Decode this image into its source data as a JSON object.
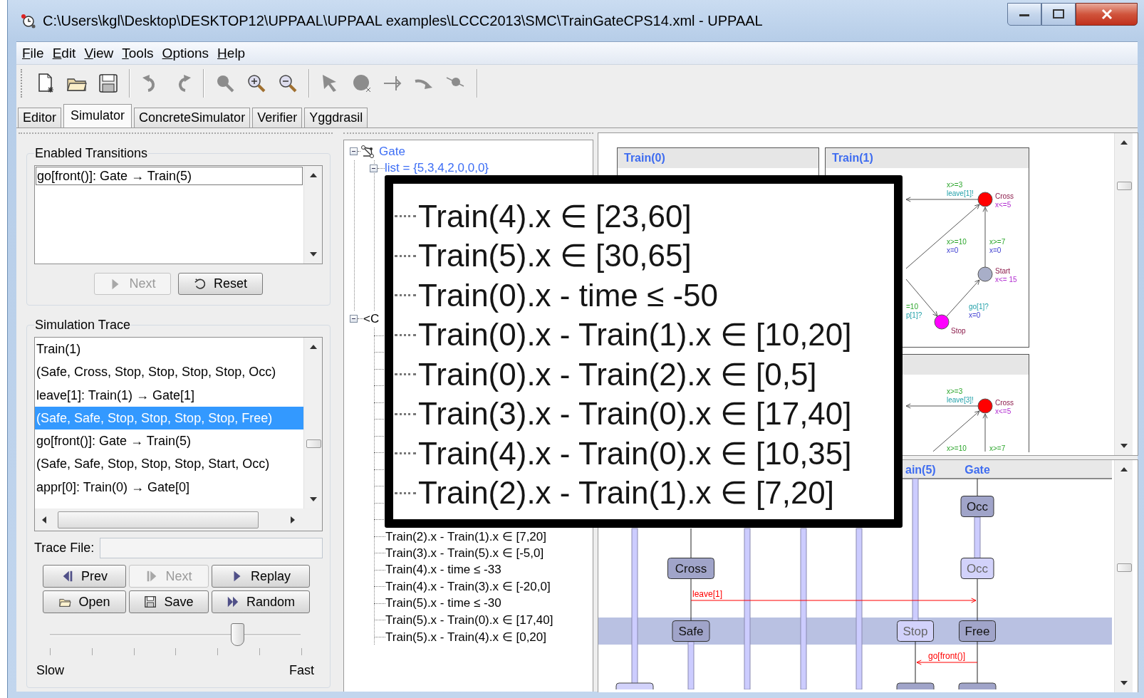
{
  "window": {
    "title": "C:\\Users\\kgl\\Desktop\\DESKTOP12\\UPPAAL\\UPPAAL examples\\LCCC2013\\SMC\\TrainGateCPS14.xml - UPPAAL"
  },
  "menu": [
    "File",
    "Edit",
    "View",
    "Tools",
    "Options",
    "Help"
  ],
  "tabs": [
    {
      "label": "Editor",
      "selected": false
    },
    {
      "label": "Simulator",
      "selected": true
    },
    {
      "label": "ConcreteSimulator",
      "selected": false
    },
    {
      "label": "Verifier",
      "selected": false
    },
    {
      "label": "Yggdrasil",
      "selected": false
    }
  ],
  "enabled_transitions": {
    "title": "Enabled Transitions",
    "items": [
      {
        "label": "go[front()]: Gate → Train(5)",
        "selected": true
      }
    ],
    "buttons": [
      {
        "label": "Next",
        "kind": "next",
        "disabled": true
      },
      {
        "label": "Reset",
        "kind": "reset",
        "disabled": false
      }
    ]
  },
  "simulation_trace": {
    "title": "Simulation Trace",
    "items": [
      {
        "label": "Train(1)",
        "selected": false
      },
      {
        "label": "(Safe, Cross, Stop, Stop, Stop, Stop, Occ)",
        "selected": false
      },
      {
        "label": "leave[1]: Train(1) → Gate[1]",
        "selected": false
      },
      {
        "label": "(Safe, Safe, Stop, Stop, Stop, Stop, Free)",
        "selected": true
      },
      {
        "label": "go[front()]: Gate → Train(5)",
        "selected": false
      },
      {
        "label": "(Safe, Safe, Stop, Stop, Stop, Start, Occ)",
        "selected": false
      },
      {
        "label": "appr[0]: Train(0) → Gate[0]",
        "selected": false
      }
    ],
    "trace_file_label": "Trace File:",
    "buttons": [
      {
        "label": "Prev",
        "kind": "prev",
        "disabled": false
      },
      {
        "label": "Next",
        "kind": "step",
        "disabled": true
      },
      {
        "label": "Replay",
        "kind": "replay",
        "disabled": false
      },
      {
        "label": "Open",
        "kind": "open",
        "disabled": false
      },
      {
        "label": "Save",
        "kind": "save",
        "disabled": false
      },
      {
        "label": "Random",
        "kind": "random",
        "disabled": false
      }
    ],
    "speed": {
      "level": 0.75,
      "min_label": "Slow",
      "max_label": "Fast"
    }
  },
  "tree": {
    "items": [
      {
        "label": "Gate",
        "kind": "process",
        "expanded": true,
        "children": [
          {
            "label": "list = {5,3,4,2,0,0,0}",
            "kind": "variable",
            "expanded": true
          }
        ]
      },
      {
        "label": "<C",
        "kind": "group",
        "expanded": true,
        "children": [
          {
            "label": "Train(2).x - Train(1).x ∈ [7,20]"
          },
          {
            "label": "Train(3).x - Train(5).x ∈ [-5,0]"
          },
          {
            "label": "Train(4).x - time ≤ -33"
          },
          {
            "label": "Train(4).x - Train(3).x ∈ [-20,0]"
          },
          {
            "label": "Train(5).x - time ≤ -30"
          },
          {
            "label": "Train(5).x - Train(0).x ∈ [17,40]"
          },
          {
            "label": "Train(5).x - Train(4).x ∈ [0,20]"
          }
        ]
      }
    ]
  },
  "processes": [
    {
      "name": "Train(0)"
    },
    {
      "name": "Train(1)",
      "locations": [
        {
          "name": "Cross",
          "invariant": "x<=5",
          "color": "#ff0000"
        },
        {
          "name": "Start",
          "invariant": "x<= 15",
          "color": "#a8aec8"
        },
        {
          "name": "Stop",
          "color": "#ff00ff"
        }
      ],
      "edges": [
        {
          "guard": "x>=3",
          "sync": "leave[1]!"
        },
        {
          "guard": "x>=10",
          "update": "x=0"
        },
        {
          "guard": "x>=7",
          "update": "x=0"
        },
        {
          "sync": "go[1]?",
          "update": "x=0"
        },
        {
          "guard": "=10",
          "sync": "p[1]?"
        }
      ]
    },
    {
      "locations": [
        {
          "name": "Cross",
          "invariant": "x<=5",
          "color": "#ff0000"
        }
      ],
      "edges": [
        {
          "guard": "x>=3",
          "sync": "leave[3]!"
        },
        {
          "guard": "x>=10"
        },
        {
          "guard": "x>=7"
        }
      ]
    }
  ],
  "msc": {
    "columns": [
      {
        "label": "ain(5)"
      },
      {
        "label": "Gate"
      }
    ],
    "states": [
      {
        "label": "Occ",
        "active": true
      },
      {
        "label": "Occ",
        "active": false
      },
      {
        "label": "Cross",
        "active": true
      },
      {
        "label": "Safe",
        "active": true
      },
      {
        "label": "Stop",
        "active": false
      },
      {
        "label": "Free",
        "active": true
      }
    ],
    "messages": [
      {
        "label": "leave[1]"
      },
      {
        "label": "go[front()]"
      }
    ]
  },
  "magnifier": {
    "lines": [
      "Train(4).x ∈ [23,60]",
      "Train(5).x ∈ [30,65]",
      "Train(0).x - time ≤ -50",
      "Train(0).x - Train(1).x ∈ [10,20]",
      "Train(0).x - Train(2).x ∈ [0,5]",
      "Train(3).x - Train(0).x ∈ [17,40]",
      "Train(4).x - Train(0).x ∈ [10,35]",
      "Train(2).x - Train(1).x ∈ [7,20]"
    ]
  }
}
